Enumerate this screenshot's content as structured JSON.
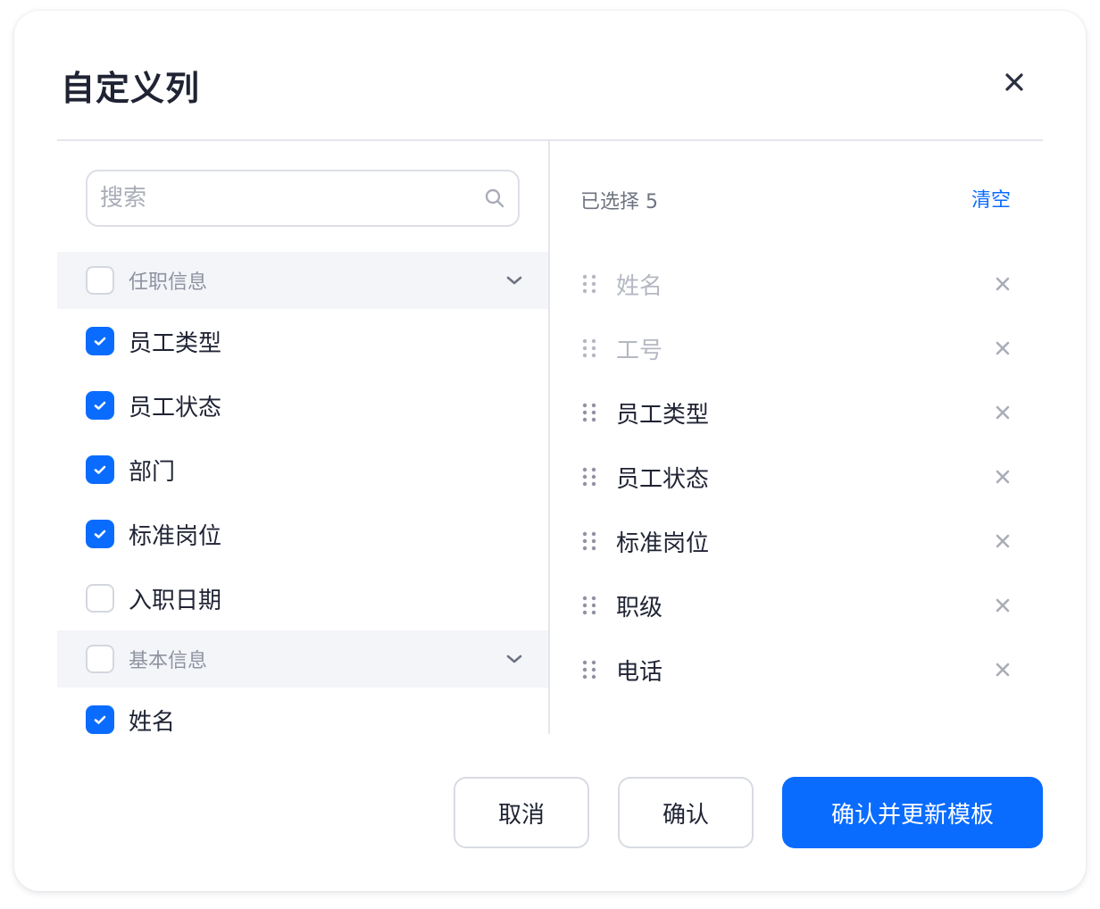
{
  "dialog": {
    "title": "自定义列",
    "close_icon": "close-icon"
  },
  "search": {
    "placeholder": "搜索",
    "value": ""
  },
  "groups": [
    {
      "label": "任职信息",
      "checked": false,
      "expanded": true,
      "items": [
        {
          "label": "员工类型",
          "checked": true
        },
        {
          "label": "员工状态",
          "checked": true
        },
        {
          "label": "部门",
          "checked": true
        },
        {
          "label": "标准岗位",
          "checked": true
        },
        {
          "label": "入职日期",
          "checked": false
        }
      ]
    },
    {
      "label": "基本信息",
      "checked": false,
      "expanded": true,
      "items": [
        {
          "label": "姓名",
          "checked": true
        }
      ]
    }
  ],
  "selected": {
    "count_label": "已选择 5",
    "clear_label": "清空",
    "items": [
      {
        "label": "姓名",
        "locked": true
      },
      {
        "label": "工号",
        "locked": true
      },
      {
        "label": "员工类型",
        "locked": false
      },
      {
        "label": "员工状态",
        "locked": false
      },
      {
        "label": "标准岗位",
        "locked": false
      },
      {
        "label": "职级",
        "locked": false
      },
      {
        "label": "电话",
        "locked": false
      }
    ]
  },
  "footer": {
    "cancel_label": "取消",
    "confirm_label": "确认",
    "confirm_update_label": "确认并更新模板"
  },
  "colors": {
    "accent": "#0a6cff",
    "text": "#1f2333",
    "muted": "#8e93a0",
    "group_bg": "#f4f5f9"
  }
}
